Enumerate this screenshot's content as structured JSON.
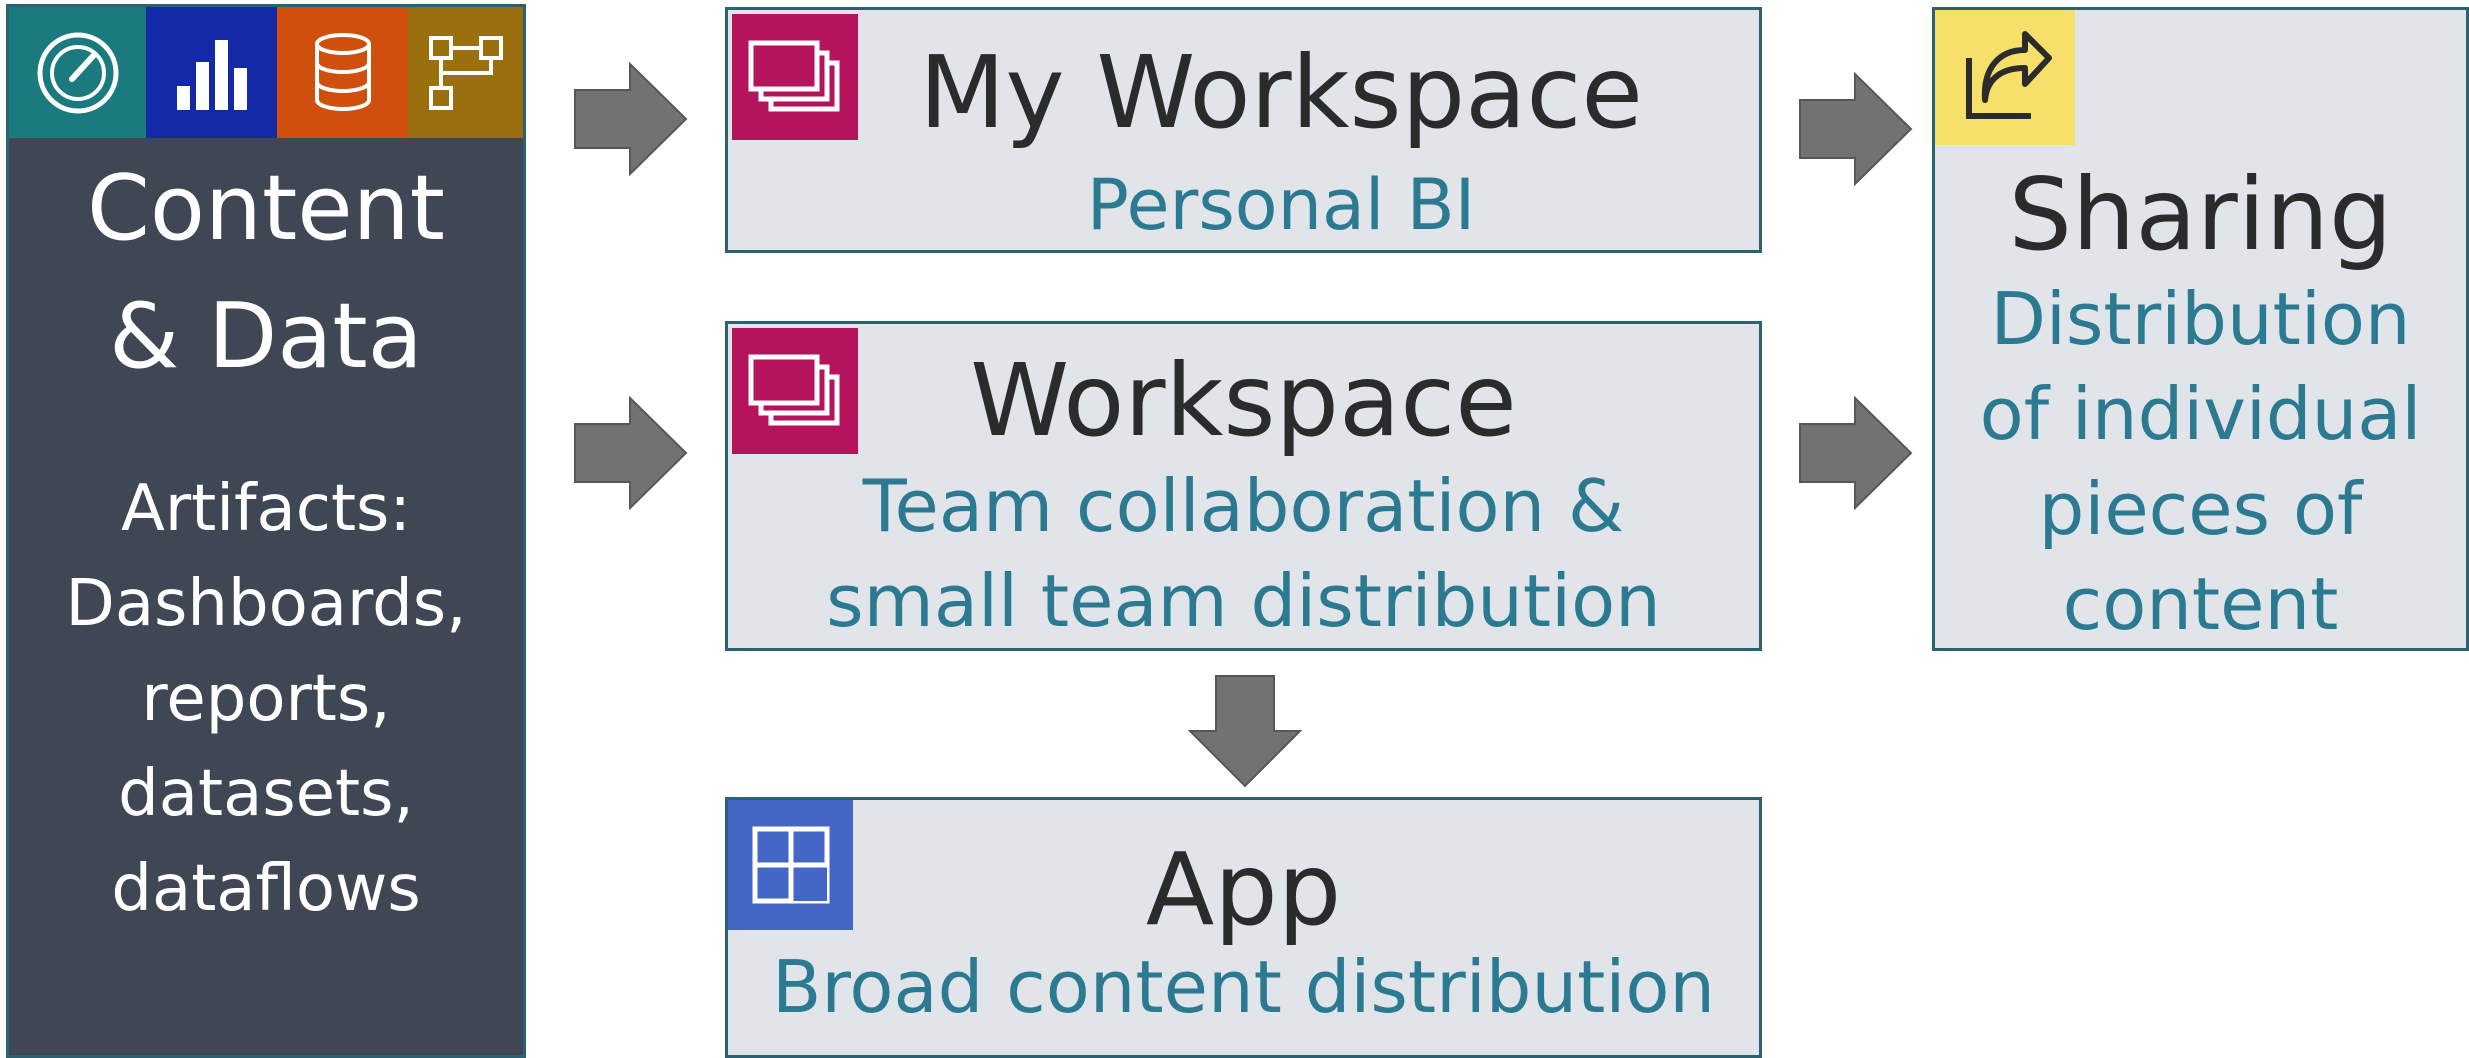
{
  "content_panel": {
    "title_line1": "Content",
    "title_line2": "& Data",
    "artifact_lines": [
      "Artifacts:",
      "Dashboards,",
      "reports,",
      "datasets,",
      "dataflows"
    ],
    "tiles": [
      {
        "icon": "gauge-icon",
        "color": "#1b7a7d"
      },
      {
        "icon": "bar-chart-icon",
        "color": "#1329a6"
      },
      {
        "icon": "database-icon",
        "color": "#d14f0d"
      },
      {
        "icon": "dataflow-icon",
        "color": "#9a6f0e"
      }
    ]
  },
  "my_workspace": {
    "title": "My Workspace",
    "subtitle": "Personal BI",
    "icon": "workspace-icon",
    "icon_color": "#b5135c"
  },
  "workspace": {
    "title": "Workspace",
    "subtitle_line1": "Team collaboration &",
    "subtitle_line2": "small team distribution",
    "icon": "workspace-icon",
    "icon_color": "#b5135c"
  },
  "app": {
    "title": "App",
    "subtitle": "Broad content distribution",
    "icon": "app-icon",
    "icon_color": "#4466c6"
  },
  "sharing": {
    "title": "Sharing",
    "subtitle_lines": [
      "Distribution",
      "of individual",
      "pieces of",
      "content"
    ],
    "icon": "share-icon",
    "icon_color": "#f7e06a"
  },
  "colors": {
    "box_fill": "#e1e4e8",
    "box_border": "#2b6272",
    "subtitle_text": "#2b7a91",
    "arrow": "#727272",
    "panel_fill": "#3f4654"
  }
}
